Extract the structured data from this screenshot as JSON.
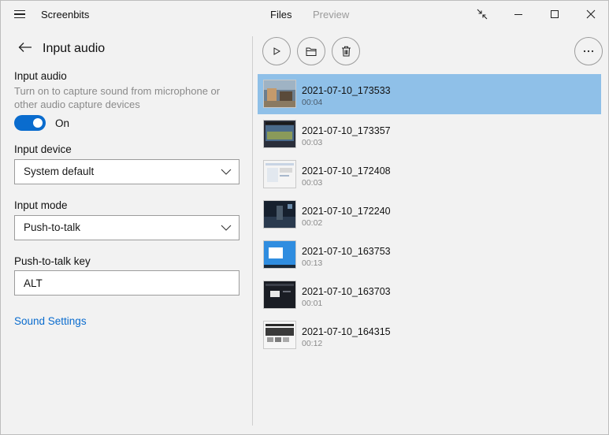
{
  "titlebar": {
    "app_title": "Screenbits",
    "tabs": [
      {
        "label": "Files",
        "active": true
      },
      {
        "label": "Preview",
        "active": false
      }
    ]
  },
  "settings": {
    "page_title": "Input audio",
    "input_audio": {
      "label": "Input audio",
      "description": "Turn on to capture sound from microphone or other audio capture devices",
      "toggle_on": true,
      "toggle_label": "On"
    },
    "input_device": {
      "label": "Input device",
      "value": "System default"
    },
    "input_mode": {
      "label": "Input mode",
      "value": "Push-to-talk"
    },
    "push_to_talk_key": {
      "label": "Push-to-talk key",
      "value": "ALT"
    },
    "sound_settings_link": "Sound Settings"
  },
  "files": [
    {
      "name": "2021-07-10_173533",
      "duration": "00:04",
      "selected": true
    },
    {
      "name": "2021-07-10_173357",
      "duration": "00:03",
      "selected": false
    },
    {
      "name": "2021-07-10_172408",
      "duration": "00:03",
      "selected": false
    },
    {
      "name": "2021-07-10_172240",
      "duration": "00:02",
      "selected": false
    },
    {
      "name": "2021-07-10_163753",
      "duration": "00:13",
      "selected": false
    },
    {
      "name": "2021-07-10_163703",
      "duration": "00:01",
      "selected": false
    },
    {
      "name": "2021-07-10_164315",
      "duration": "00:12",
      "selected": false
    }
  ],
  "colors": {
    "accent": "#0a6cce",
    "selection": "#8fc0e8",
    "background": "#f2f2f2"
  },
  "icons": {
    "menu": "hamburger-icon",
    "compact": "compact-overlay-icon",
    "minimize": "minimize-icon",
    "maximize": "maximize-icon",
    "close": "close-icon",
    "back": "back-arrow-icon",
    "play": "play-icon",
    "folder": "folder-icon",
    "delete": "trash-icon",
    "more": "more-icon"
  }
}
